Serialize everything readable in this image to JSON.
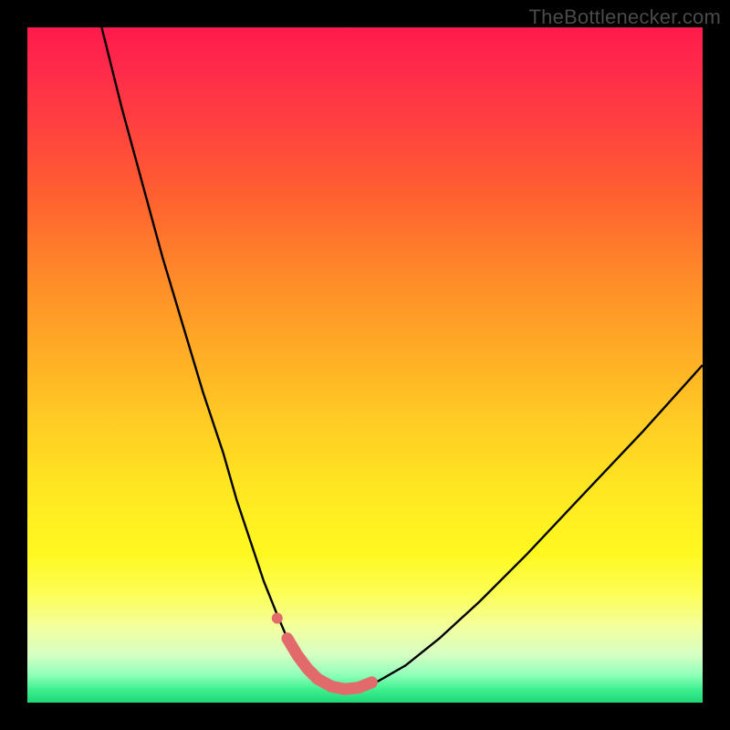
{
  "watermark": {
    "text": "TheBottlenecker.com"
  },
  "background_frame_color": "#000000",
  "chart_data": {
    "type": "line",
    "title": "",
    "xlabel": "",
    "ylabel": "",
    "xlim": [
      0,
      100
    ],
    "ylim": [
      0,
      100
    ],
    "grid": false,
    "legend": false,
    "gradient_stops": [
      {
        "pos": 0,
        "color": "#ff1a4d"
      },
      {
        "pos": 14,
        "color": "#ff4040"
      },
      {
        "pos": 35,
        "color": "#ff842a"
      },
      {
        "pos": 57,
        "color": "#ffc824"
      },
      {
        "pos": 78,
        "color": "#fff820"
      },
      {
        "pos": 93,
        "color": "#d4ffc4"
      },
      {
        "pos": 100,
        "color": "#1cd878"
      }
    ],
    "series": [
      {
        "name": "bottleneck-curve",
        "stroke": "#000000",
        "stroke_width": 2.4,
        "x": [
          11,
          14,
          17,
          20,
          23,
          26,
          29,
          31,
          33,
          35,
          37,
          38.5,
          40,
          41.5,
          43,
          45,
          47,
          49,
          52,
          56,
          61,
          67,
          74,
          82,
          91,
          100
        ],
        "y": [
          100,
          88,
          77,
          66,
          56,
          46,
          37,
          30,
          24,
          18,
          13,
          9.5,
          7,
          5,
          3.5,
          2.4,
          2,
          2.2,
          3.2,
          5.5,
          9.5,
          15,
          22,
          30.5,
          40,
          50
        ]
      },
      {
        "name": "marker-band",
        "stroke": "#e26a6a",
        "stroke_width": 13,
        "linecap": "round",
        "x": [
          38.5,
          40,
          41.5,
          43,
          45,
          47,
          49,
          51
        ],
        "y": [
          9.5,
          7,
          5,
          3.5,
          2.4,
          2,
          2.2,
          3.0
        ]
      },
      {
        "name": "marker-dot",
        "type_hint": "scatter",
        "fill": "#e26a6a",
        "radius": 6,
        "x": [
          37.0
        ],
        "y": [
          12.5
        ]
      }
    ]
  }
}
